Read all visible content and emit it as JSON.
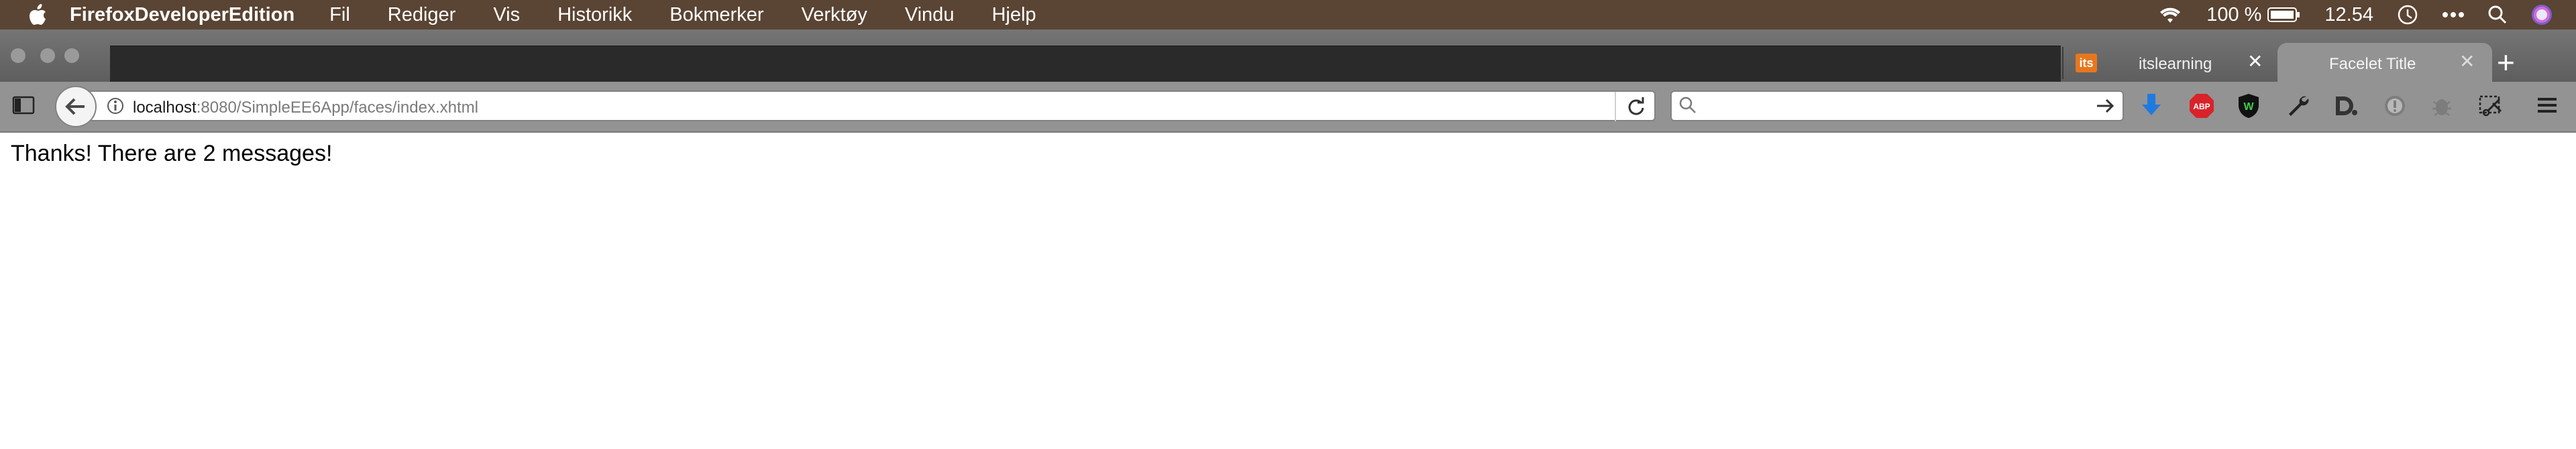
{
  "menubar": {
    "app_name": "FirefoxDeveloperEdition",
    "menus": [
      "Fil",
      "Rediger",
      "Vis",
      "Historikk",
      "Bokmerker",
      "Verktøy",
      "Vindu",
      "Hjelp"
    ],
    "battery_percent": "100 %",
    "clock": "12.54",
    "background": "#5a4433"
  },
  "tabs": [
    {
      "label": "itslearning",
      "favicon_text": "its",
      "favicon_color": "#e7771e",
      "active": false
    },
    {
      "label": "Facelet Title",
      "active": true
    }
  ],
  "toolbar": {
    "url_host": "localhost",
    "url_rest": ":8080/SimpleEE6App/faces/index.xhtml",
    "search_placeholder": "",
    "extension_icons": [
      "download-icon",
      "adblock-icon",
      "shield-w-icon",
      "wrench-icon",
      "dashlane-icon",
      "info-circle-icon",
      "bug-icon",
      "screenshot-icon",
      "hamburger-menu-icon"
    ]
  },
  "content": {
    "message": "Thanks! There are 2 messages!"
  }
}
